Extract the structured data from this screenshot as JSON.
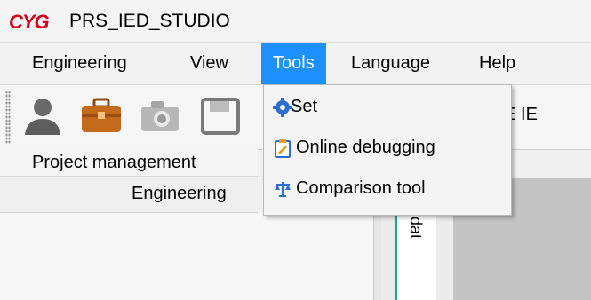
{
  "app": {
    "logo_text": "CYG",
    "title": "PRS_IED_STUDIO"
  },
  "menubar": {
    "items": [
      {
        "label": "Engineering",
        "active": false
      },
      {
        "label": "View",
        "active": false
      },
      {
        "label": "Tools",
        "active": true
      },
      {
        "label": "Language",
        "active": false
      },
      {
        "label": "Help",
        "active": false
      }
    ]
  },
  "toolbar": {
    "icons": [
      "user-icon",
      "briefcase-icon",
      "camera-icon",
      "save-icon"
    ],
    "partial_text": "TIVE IE"
  },
  "tools_menu": {
    "items": [
      {
        "label": "Set",
        "icon": "gear-icon"
      },
      {
        "label": "Online debugging",
        "icon": "clipboard-icon"
      },
      {
        "label": "Comparison tool",
        "icon": "compare-icon"
      }
    ]
  },
  "panels": {
    "project_management": "Project management",
    "engineering": "Engineering",
    "vertical_tab": "dat"
  },
  "colors": {
    "menu_active": "#1e90ff",
    "logo": "#d4001a",
    "tab_accent": "#1aa39a"
  }
}
